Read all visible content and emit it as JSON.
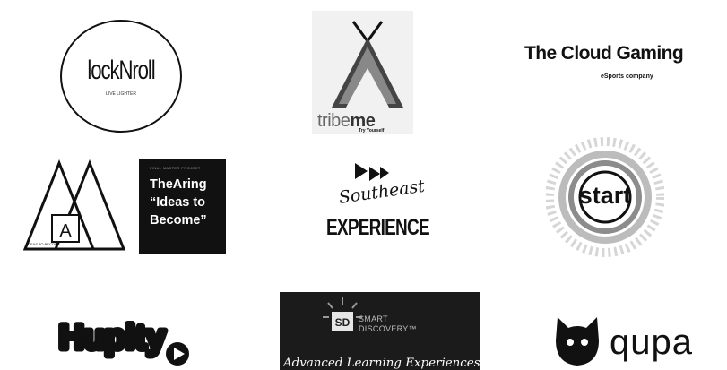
{
  "logos": {
    "locknroll": {
      "name": "lockNroll",
      "tagline": "LIVE LIGHTER"
    },
    "tribeme": {
      "name_part1": "tribe",
      "name_part2": "me",
      "tagline": "Try Yourself!"
    },
    "cloud_gaming": {
      "name": "The Cloud Gaming",
      "tagline": "eSports company"
    },
    "thearing": {
      "small_caption": "FINAL MASTER PROJECT",
      "title": "TheAring\n“Ideas to\nBecome”",
      "mark_letter": "A",
      "mark_caption": "IDEAS TO BECOME"
    },
    "southeast": {
      "script_text": "Southeast",
      "block_text": "EXPERIENCE"
    },
    "start": {
      "name": "start"
    },
    "hupity": {
      "name": "Hupity"
    },
    "smart_discovery": {
      "badge": "SD",
      "line1": "SMART",
      "line2": "DISCOVERY™",
      "tagline": "Advanced Learning Experiences"
    },
    "qupa": {
      "name": "qupa"
    }
  }
}
